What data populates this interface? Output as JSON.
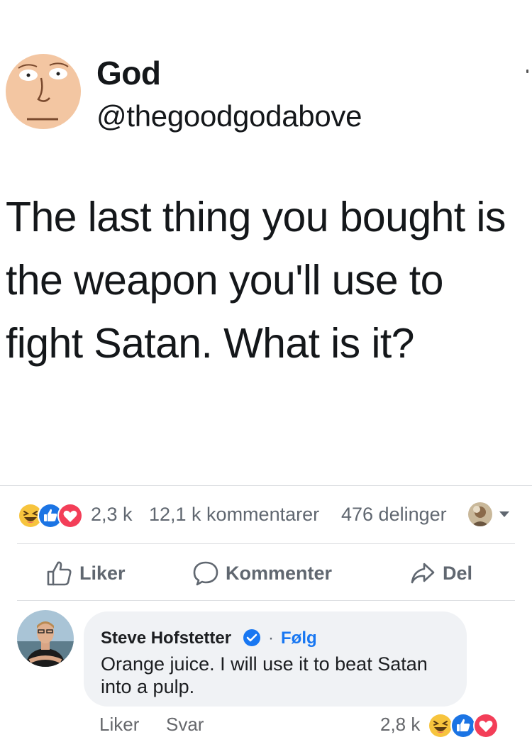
{
  "tweet": {
    "author_name": "God",
    "author_handle": "@thegoodgodabove",
    "text": "The last thing you bought is the weapon you'll use to fight Satan. What is it?"
  },
  "post_summary": {
    "reaction_count": "2,3 k",
    "comment_count": "12,1 k kommentarer",
    "share_count": "476 delinger",
    "reaction_icons": [
      "haha-icon",
      "like-icon",
      "love-icon"
    ]
  },
  "actions": {
    "like_label": "Liker",
    "comment_label": "Kommenter",
    "share_label": "Del"
  },
  "comment": {
    "author_name": "Steve Hofstetter",
    "separator": "·",
    "follow_label": "Følg",
    "text": "Orange juice. I will use it to beat Satan into a pulp.",
    "like_label": "Liker",
    "reply_label": "Svar",
    "reaction_count": "2,8 k"
  },
  "colors": {
    "link_blue": "#1877f2",
    "secondary_text": "#606770",
    "bubble_bg": "#f0f2f5",
    "like_blue": "#1b74e4",
    "love_red": "#f33e58",
    "haha_yellow": "#f7c43d"
  }
}
